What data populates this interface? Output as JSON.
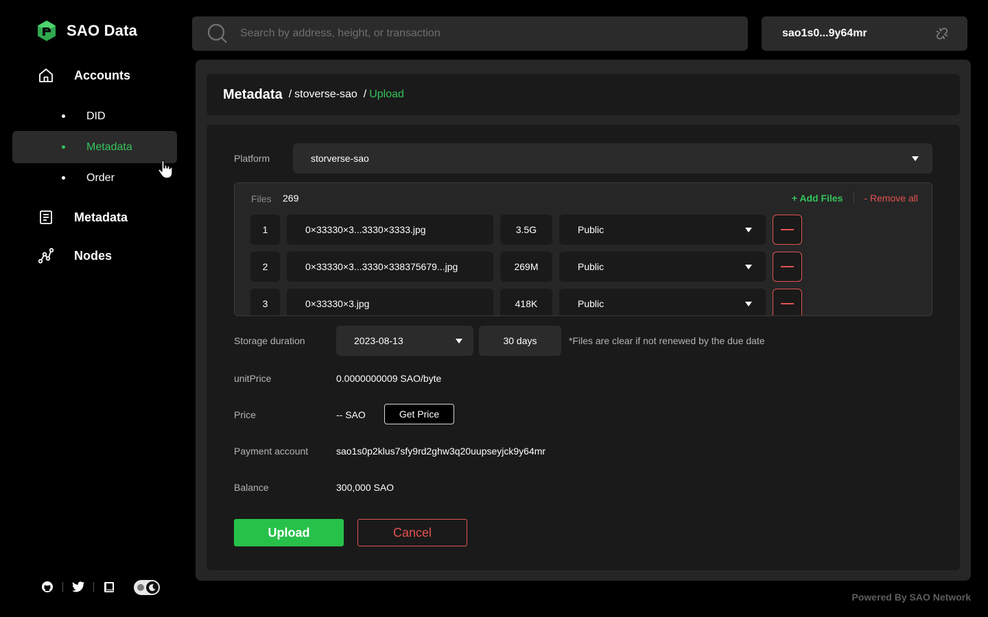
{
  "brand": {
    "name": "SAO Data",
    "accent": "#33c45a",
    "danger": "#e45252"
  },
  "sidebar": {
    "accounts": {
      "label": "Accounts",
      "icon": "home-icon"
    },
    "sub_items": [
      {
        "label": "DID",
        "active": false
      },
      {
        "label": "Metadata",
        "active": true
      },
      {
        "label": "Order",
        "active": false
      }
    ],
    "metadata": {
      "label": "Metadata",
      "icon": "document-icon"
    },
    "nodes": {
      "label": "Nodes",
      "icon": "nodes-icon"
    },
    "footer_icons": [
      "github-icon",
      "twitter-icon",
      "book-icon"
    ],
    "theme_toggle": "dark"
  },
  "search": {
    "placeholder": "Search by address, height, or transaction"
  },
  "wallet": {
    "address": "sao1s0...9y64mr",
    "icon": "unlink-icon"
  },
  "breadcrumb": {
    "title": "Metadata",
    "sep": "/",
    "items": [
      "stoverse-sao",
      "Upload"
    ]
  },
  "form": {
    "platform": {
      "label": "Platform",
      "value": "storverse-sao"
    },
    "files": {
      "label": "Files",
      "count": "269",
      "add_label": "+ Add Files",
      "remove_label": "- Remove all",
      "rows": [
        {
          "index": "1",
          "name": "0×33330×3...3330×3333.jpg",
          "size": "3.5G",
          "permission": "Public"
        },
        {
          "index": "2",
          "name": "0×33330×3...3330×338375679...jpg",
          "size": "269M",
          "permission": "Public"
        },
        {
          "index": "3",
          "name": "0×33330×3.jpg",
          "size": "418K",
          "permission": "Public"
        }
      ]
    },
    "storage": {
      "label": "Storage duration",
      "date": "2023-08-13",
      "days": "30 days",
      "note": "*Files are clear if not renewed by the due date"
    },
    "unit_price": {
      "label": "unitPrice",
      "value": "0.0000000009 SAO/byte"
    },
    "price": {
      "label": "Price",
      "value": "-- SAO",
      "button": "Get Price"
    },
    "payment": {
      "label": "Payment account",
      "value": "sao1s0p2klus7sfy9rd2ghw3q20uupseyjck9y64mr"
    },
    "balance": {
      "label": "Balance",
      "value": "300,000 SAO"
    },
    "upload_button": "Upload",
    "cancel_button": "Cancel"
  },
  "footer": {
    "powered": "Powered By SAO Network"
  }
}
